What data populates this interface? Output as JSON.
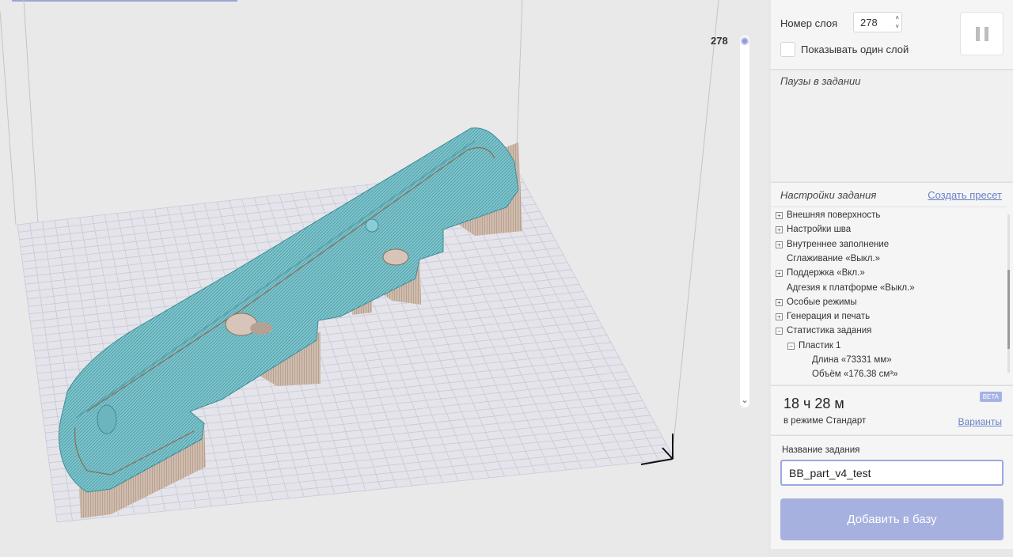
{
  "viewport": {
    "layer_slider_value": "278",
    "layer_slider_position": 1.0
  },
  "panel": {
    "layer": {
      "label": "Номер слоя",
      "value": "278",
      "show_single_label": "Показывать один слой",
      "show_single_checked": false
    },
    "pauses": {
      "title": "Паузы в задании"
    },
    "settings": {
      "title": "Настройки задания",
      "create_preset": "Создать пресет",
      "items": [
        {
          "label": "Внешняя поверхность",
          "toggle": "+",
          "level": 0
        },
        {
          "label": "Настройки шва",
          "toggle": "+",
          "level": 0
        },
        {
          "label": "Внутреннее заполнение",
          "toggle": "+",
          "level": 0
        },
        {
          "label": "Сглаживание «Выкл.»",
          "toggle": "",
          "level": 0
        },
        {
          "label": "Поддержка «Вкл.»",
          "toggle": "+",
          "level": 0
        },
        {
          "label": "Адгезия к платформе «Выкл.»",
          "toggle": "",
          "level": 0
        },
        {
          "label": "Особые режимы",
          "toggle": "+",
          "level": 0
        },
        {
          "label": "Генерация и печать",
          "toggle": "+",
          "level": 0
        },
        {
          "label": "Статистика задания",
          "toggle": "−",
          "level": 0
        },
        {
          "label": "Пластик 1",
          "toggle": "−",
          "level": 1
        },
        {
          "label": "Длина «73331 мм»",
          "toggle": "",
          "level": 2
        },
        {
          "label": "Объём «176.38 см³»",
          "toggle": "",
          "level": 2
        }
      ]
    },
    "estimate": {
      "time": "18 ч 28 м",
      "mode": "в режиме Стандарт",
      "beta": "BETA",
      "variants": "Варианты"
    },
    "job": {
      "label": "Название задания",
      "name": "BB_part_v4_test",
      "add_button": "Добавить в базу"
    }
  },
  "colors": {
    "accent": "#a6b1e0",
    "link": "#6a80c8",
    "model_top": "#7cc4cc",
    "model_side": "#c8b4a4"
  }
}
